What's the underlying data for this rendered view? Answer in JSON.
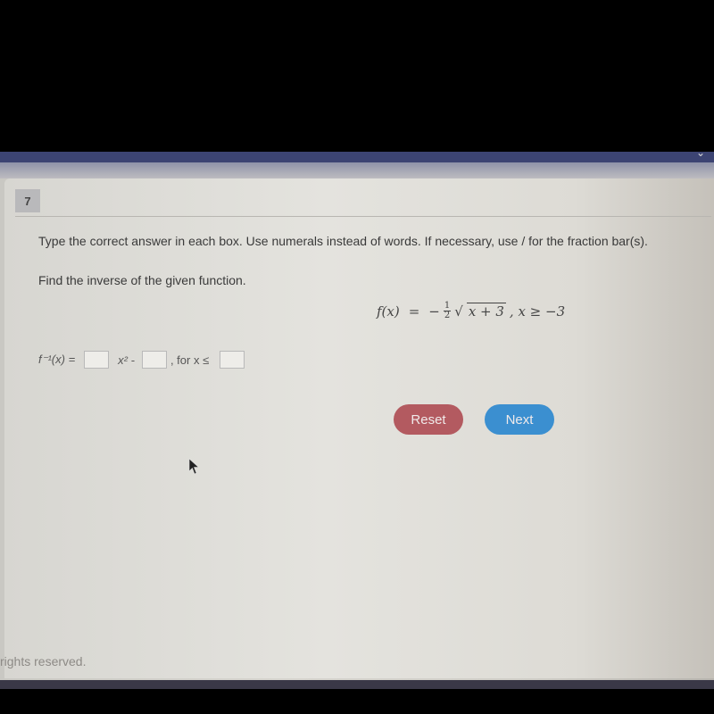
{
  "question": {
    "number": "7",
    "instruction": "Type the correct answer in each box. Use numerals instead of words. If necessary, use / for the fraction bar(s).",
    "prompt": "Find the inverse of the given function.",
    "formula": {
      "lhs": "f(x)",
      "equals": "=",
      "sign": "−",
      "frac_num": "1",
      "frac_den": "2",
      "radical": "√",
      "radicand": "x + 3",
      "condition": ", x ≥ −3"
    },
    "answer": {
      "lhs_label": "f⁻¹(x) =",
      "box1_value": "",
      "mid_label": "x² -",
      "box2_value": "",
      "domain_label": ", for x ≤",
      "box3_value": ""
    }
  },
  "buttons": {
    "reset": "Reset",
    "next": "Next"
  },
  "colors": {
    "reset": "#b35a60",
    "next": "#3b8fd0",
    "topbar": "#3c4473"
  },
  "footer": {
    "text": "rights reserved."
  }
}
